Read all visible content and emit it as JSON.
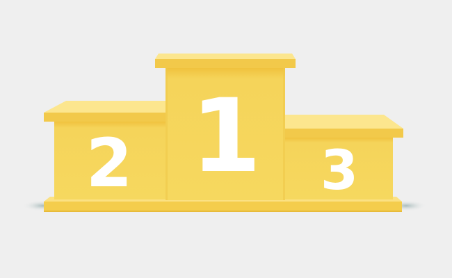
{
  "podium": {
    "places": [
      {
        "rank": "1",
        "position": "center"
      },
      {
        "rank": "2",
        "position": "left"
      },
      {
        "rank": "3",
        "position": "right"
      }
    ]
  },
  "colors": {
    "background": "#efefef",
    "front": "#f5d65c",
    "cap_front": "#f2c94a",
    "top_surface": "#fce68e",
    "shadow": "#b9c9c9",
    "numeral": "#ffffff"
  }
}
